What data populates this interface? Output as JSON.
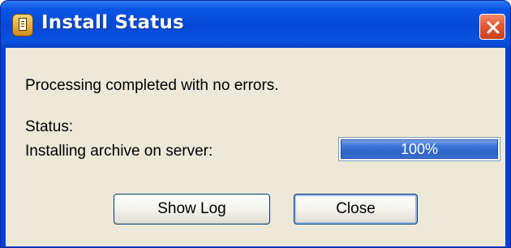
{
  "window": {
    "title": "Install Status",
    "icon": "setup-package-icon",
    "close_icon": "close-icon",
    "close_color": "#e25a32",
    "titlebar_color": "#0648d6"
  },
  "content": {
    "message": "Processing completed with no errors.",
    "status_label": "Status:",
    "task_label": "Installing archive on server:",
    "progress": {
      "value_percent": 100,
      "text": "100%",
      "fill_color": "#2c63c6"
    }
  },
  "buttons": {
    "show_log": "Show Log",
    "close": "Close"
  }
}
